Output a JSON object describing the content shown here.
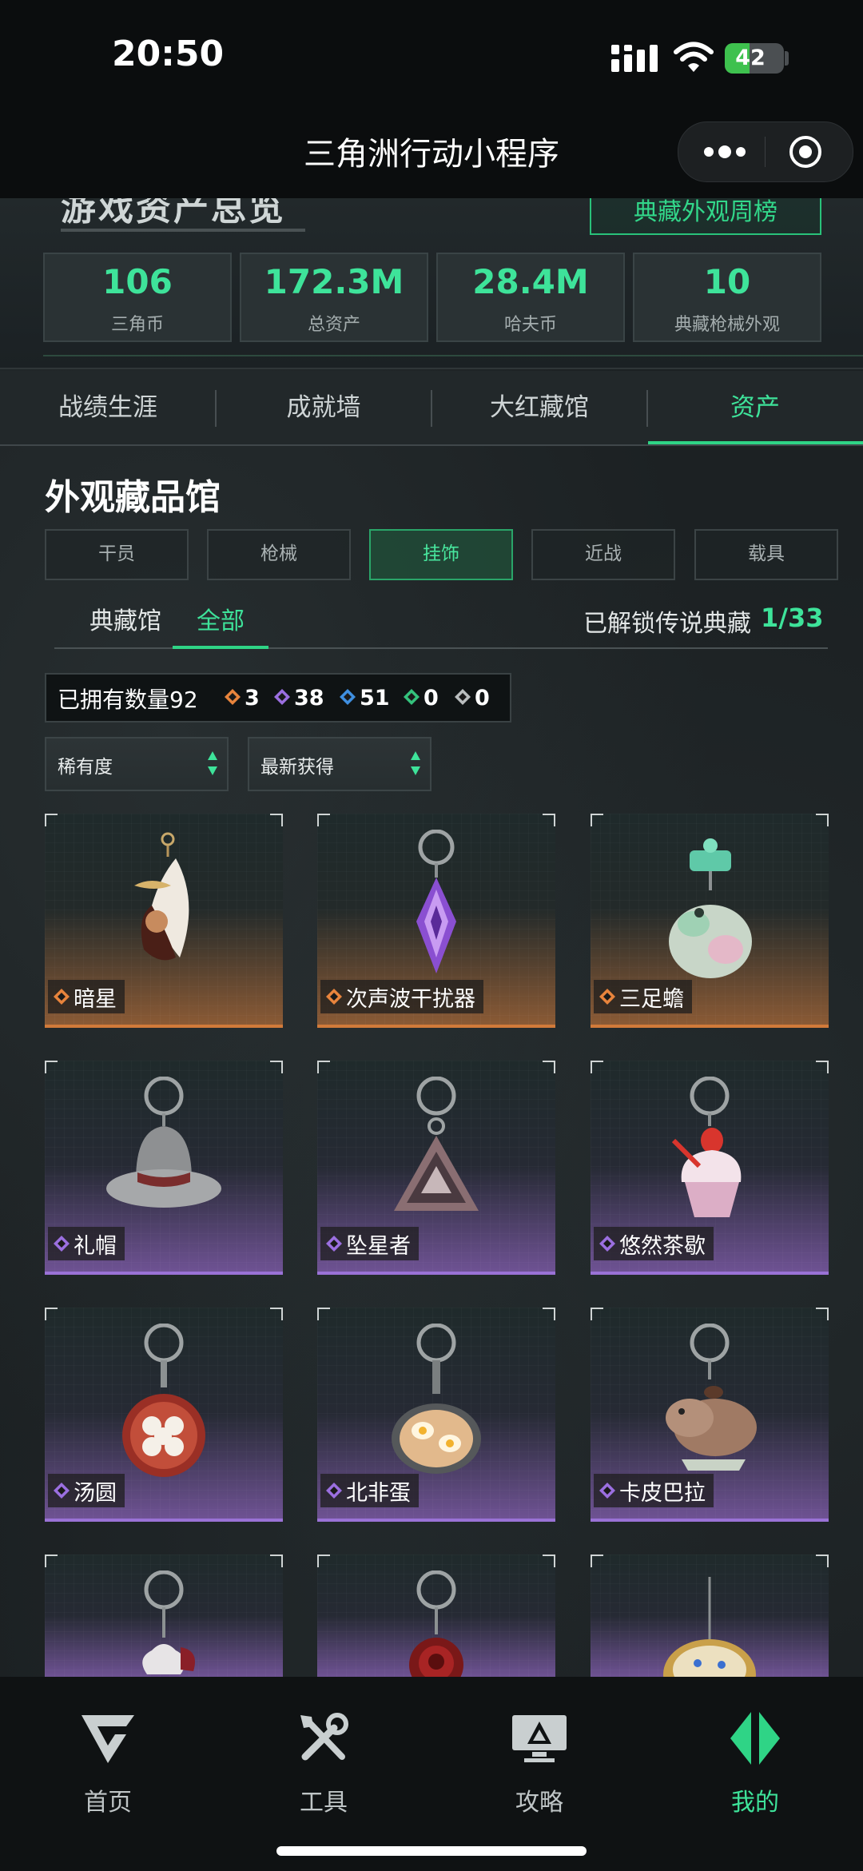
{
  "status_bar": {
    "time": "20:50",
    "battery": "42",
    "battery_level": 0.42
  },
  "title_bar": {
    "title": "三角洲行动小程序"
  },
  "overview": {
    "heading": "游戏资产总览",
    "weekly_button": "典藏外观周榜",
    "stats": [
      {
        "value": "106",
        "label": "三角币"
      },
      {
        "value": "172.3M",
        "label": "总资产"
      },
      {
        "value": "28.4M",
        "label": "哈夫币"
      },
      {
        "value": "10",
        "label": "典藏枪械外观"
      }
    ]
  },
  "profile_tabs": [
    "战绩生涯",
    "成就墙",
    "大红藏馆",
    "资产"
  ],
  "profile_tab_active": "资产",
  "gallery": {
    "title": "外观藏品馆",
    "categories": [
      "干员",
      "枪械",
      "挂饰",
      "近战",
      "载具"
    ],
    "category_active": "挂饰",
    "sub_tabs": [
      "典藏馆",
      "全部"
    ],
    "sub_tab_active": "全部",
    "unlock_label": "已解锁传说典藏",
    "unlock_count": "1/33",
    "owned_label": "已拥有数量92",
    "rarity_counts": [
      {
        "icon": "orange-diamond-icon",
        "count": "3",
        "color": "#e8843c"
      },
      {
        "icon": "purple-diamond-icon",
        "count": "38",
        "color": "#9b6fe0"
      },
      {
        "icon": "blue-diamond-icon",
        "count": "51",
        "color": "#3f8fe0"
      },
      {
        "icon": "green-diamond-icon",
        "count": "0",
        "color": "#34c27c"
      },
      {
        "icon": "gray-diamond-icon",
        "count": "0",
        "color": "#b9bdbe"
      }
    ],
    "sort_rarity": "稀有度",
    "sort_latest": "最新获得",
    "items": [
      {
        "name": "暗星",
        "rarity": "gold",
        "art": "hooded-figure-charm"
      },
      {
        "name": "次声波干扰器",
        "rarity": "gold",
        "art": "purple-crystal-charm"
      },
      {
        "name": "三足蟾",
        "rarity": "gold",
        "art": "jade-toad-charm"
      },
      {
        "name": "礼帽",
        "rarity": "purple",
        "art": "fedora-hat-charm"
      },
      {
        "name": "坠星者",
        "rarity": "purple",
        "art": "triangle-emblem-charm"
      },
      {
        "name": "悠然茶歇",
        "rarity": "purple",
        "art": "cupcake-charm"
      },
      {
        "name": "汤圆",
        "rarity": "purple",
        "art": "tangyuan-pan-charm"
      },
      {
        "name": "北非蛋",
        "rarity": "purple",
        "art": "egg-pan-charm"
      },
      {
        "name": "卡皮巴拉",
        "rarity": "purple",
        "art": "capybara-charm"
      }
    ]
  },
  "bottom_nav": [
    {
      "label": "首页",
      "icon": "home-logo-icon"
    },
    {
      "label": "工具",
      "icon": "tools-icon"
    },
    {
      "label": "攻略",
      "icon": "guide-monitor-icon"
    },
    {
      "label": "我的",
      "icon": "profile-logo-icon"
    }
  ],
  "bottom_nav_active": "我的",
  "colors": {
    "accent": "#3ee39a",
    "gold": "#d17a3a",
    "purple": "#9a72d6"
  }
}
